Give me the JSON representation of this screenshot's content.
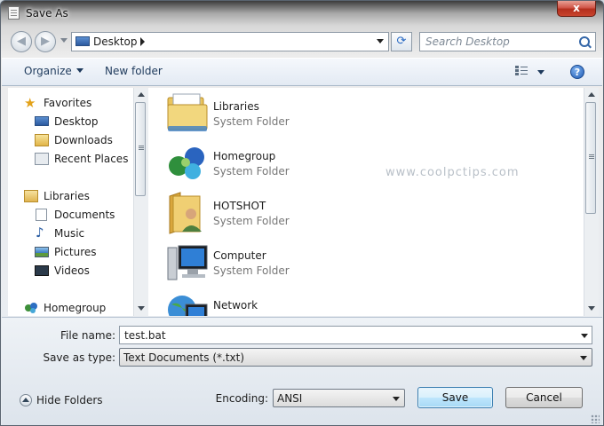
{
  "window": {
    "title": "Save As",
    "close_glyph": "x"
  },
  "nav": {
    "back_icon": "back-arrow-icon",
    "forward_icon": "forward-arrow-icon",
    "address": "Desktop",
    "refresh_glyph": "⟳",
    "search_placeholder": "Search Desktop"
  },
  "toolbar": {
    "organize": "Organize",
    "new_folder": "New folder",
    "help_glyph": "?"
  },
  "sidebar": {
    "favorites": {
      "label": "Favorites",
      "items": [
        "Desktop",
        "Downloads",
        "Recent Places"
      ]
    },
    "libraries": {
      "label": "Libraries",
      "items": [
        "Documents",
        "Music",
        "Pictures",
        "Videos"
      ]
    },
    "homegroup": "Homegroup"
  },
  "files": [
    {
      "name": "Libraries",
      "type": "System Folder",
      "icon": "libraries-icon"
    },
    {
      "name": "Homegroup",
      "type": "System Folder",
      "icon": "homegroup-icon"
    },
    {
      "name": "HOTSHOT",
      "type": "System Folder",
      "icon": "user-folder-icon"
    },
    {
      "name": "Computer",
      "type": "System Folder",
      "icon": "computer-icon"
    },
    {
      "name": "Network",
      "type": "",
      "icon": "network-icon"
    }
  ],
  "watermark": "www.coolpctips.com",
  "form": {
    "file_name_label": "File name:",
    "file_name_value": "test.bat",
    "save_type_label": "Save as type:",
    "save_type_value": "Text Documents (*.txt)",
    "encoding_label": "Encoding:",
    "encoding_value": "ANSI"
  },
  "footer": {
    "hide_folders": "Hide Folders",
    "save": "Save",
    "cancel": "Cancel"
  },
  "colors": {
    "accent": "#3c7fb1",
    "close": "#c8442e",
    "link": "#1e3a5c"
  }
}
